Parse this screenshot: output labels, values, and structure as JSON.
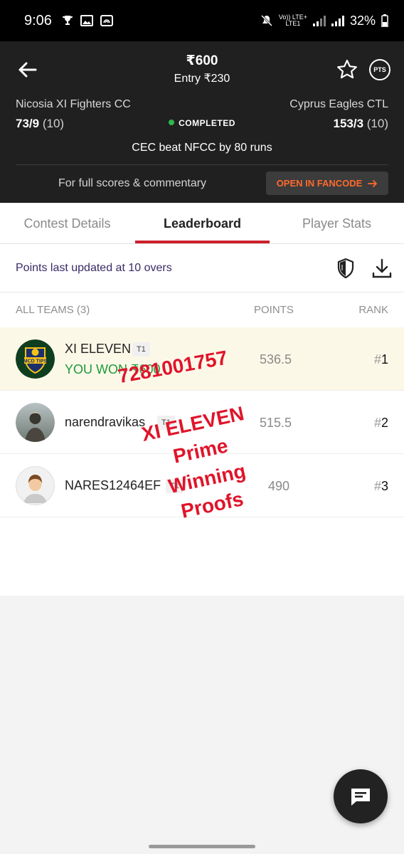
{
  "status_bar": {
    "time": "9:06",
    "network_top": "Vo)) LTE+",
    "network_bottom": "LTE1",
    "battery": "32%"
  },
  "header": {
    "prize": "₹600",
    "entry": "Entry ₹230",
    "pts_badge": "PTS",
    "team_left": {
      "name": "Nicosia XI Fighters CC",
      "score": "73/9",
      "overs": "(10)"
    },
    "team_right": {
      "name": "Cyprus Eagles CTL",
      "score": "153/3",
      "overs": "(10)"
    },
    "match_status": "COMPLETED",
    "result": "CEC beat NFCC by 80 runs",
    "full_scores_text": "For full scores & commentary",
    "fancode_button": "OPEN IN FANCODE",
    "status_color": "#2fb84d",
    "accent_color": "#ff6a2c"
  },
  "tabs": [
    {
      "label": "Contest Details",
      "active": false
    },
    {
      "label": "Leaderboard",
      "active": true
    },
    {
      "label": "Player Stats",
      "active": false
    }
  ],
  "leaderboard": {
    "updated_text": "Points last updated at 10 overs",
    "col_teams": "ALL TEAMS (3)",
    "col_points": "POINTS",
    "col_rank": "RANK",
    "rows": [
      {
        "name": "XI ELEVEN",
        "tag": "T1",
        "won": "YOU WON ₹600",
        "points": "536.5",
        "hash": "#",
        "rank": "1"
      },
      {
        "name": "narendravikas",
        "tag": "T1",
        "points": "515.5",
        "hash": "#",
        "rank": "2"
      },
      {
        "name": "NARES12464EF",
        "tag": "T1",
        "points": "490",
        "hash": "#",
        "rank": "3"
      }
    ]
  },
  "avatar_logo_text": "MCD TIPS",
  "watermark": {
    "phone": "7281001757",
    "line1": "XI ELEVEN",
    "line2": "Prime",
    "line3": "Winning",
    "line4": "Proofs"
  }
}
